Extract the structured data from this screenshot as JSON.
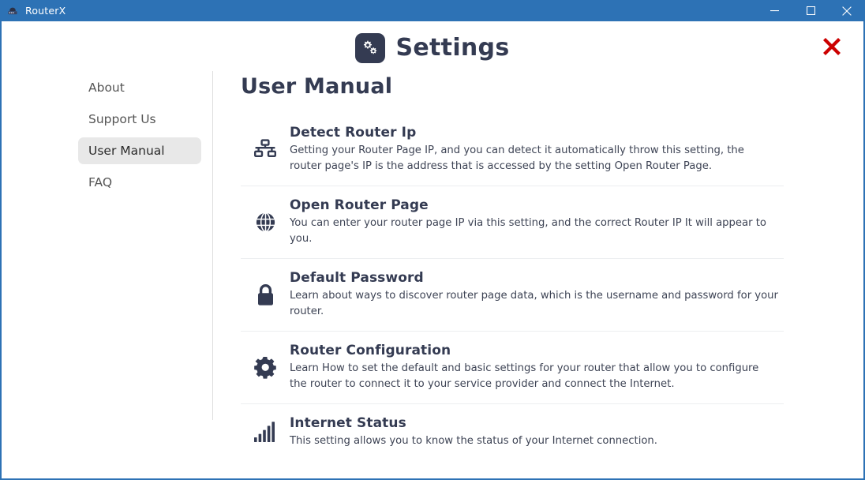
{
  "window": {
    "app_title": "RouterX",
    "app_icon": "router-icon",
    "accent_color": "#2d72b5",
    "controls": [
      {
        "name": "minimize-button",
        "icon": "minimize-icon",
        "label": "Minimize"
      },
      {
        "name": "maximize-button",
        "icon": "maximize-icon",
        "label": "Maximize"
      },
      {
        "name": "close-button",
        "icon": "window-close-icon",
        "label": "Close"
      }
    ]
  },
  "header": {
    "title": "Settings",
    "icon": "gears-icon",
    "icon_bg": "#343b52",
    "title_color": "#343b52",
    "close_icon": "red-x-close-icon",
    "close_color": "#cc0000"
  },
  "sidebar": {
    "items": [
      {
        "label": "About",
        "name": "sidebar-item-about",
        "active": false
      },
      {
        "label": "Support Us",
        "name": "sidebar-item-support-us",
        "active": false
      },
      {
        "label": "User Manual",
        "name": "sidebar-item-user-manual",
        "active": true
      },
      {
        "label": "FAQ",
        "name": "sidebar-item-faq",
        "active": false
      }
    ],
    "active_bg": "#e8e8e8"
  },
  "main": {
    "page_title": "User Manual",
    "items": [
      {
        "icon": "sitemap-icon",
        "name": "Detect Router Ip",
        "description": "Getting your Router Page IP, and you can detect it automatically throw this setting, the router page's IP is the address that is accessed by the setting Open Router Page."
      },
      {
        "icon": "globe-icon",
        "name": "Open Router Page",
        "description": "You can enter your router page IP via this setting, and the correct Router IP It will appear to you."
      },
      {
        "icon": "lock-icon",
        "name": "Default Password",
        "description": "Learn about ways to discover router page data, which is the username and password for your router."
      },
      {
        "icon": "gear-icon",
        "name": "Router Configuration",
        "description": "Learn How to set the default and basic settings for your router that allow you to configure the router to connect it to your service provider and connect the Internet."
      },
      {
        "icon": "signal-bars-icon",
        "name": "Internet Status",
        "description": "This setting allows you to know the status of your Internet connection."
      }
    ]
  }
}
